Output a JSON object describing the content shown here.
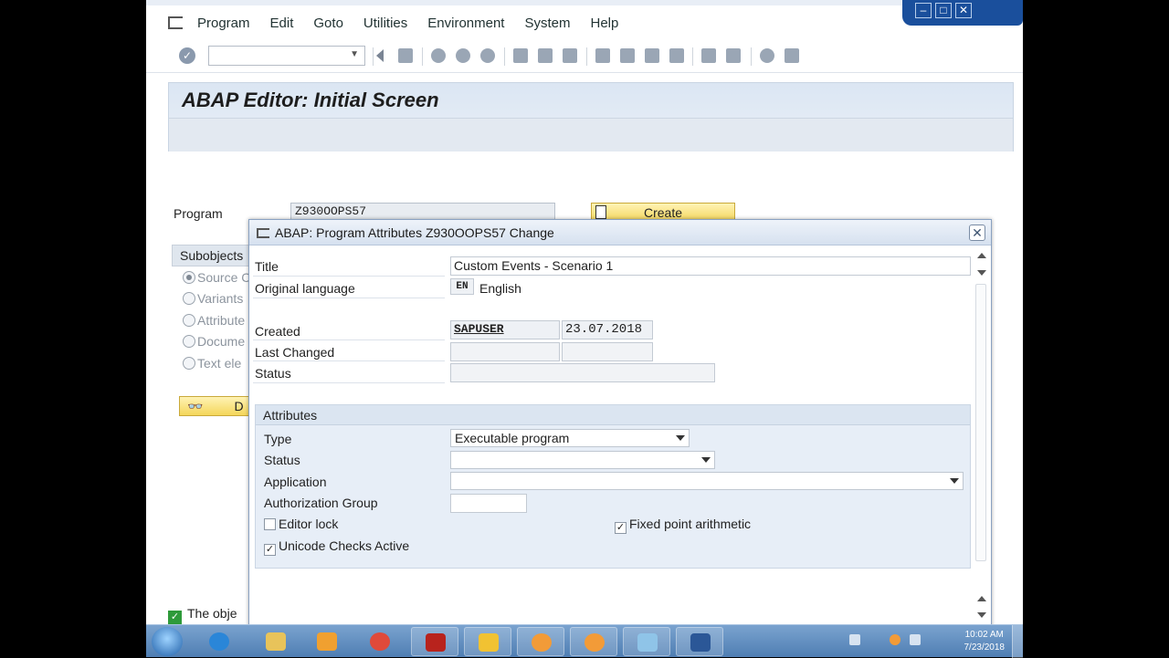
{
  "menu": {
    "items": [
      "Program",
      "Edit",
      "Goto",
      "Utilities",
      "Environment",
      "System",
      "Help"
    ]
  },
  "toolbar": {
    "command_value": ""
  },
  "screen": {
    "title": "ABAP Editor: Initial Screen",
    "program_label": "Program",
    "program_value": "Z930OOPS57",
    "create_label": "Create",
    "subobjects_label": "Subobjects",
    "radios": [
      "Source C",
      "Variants",
      "Attribute",
      "Docume",
      "Text ele"
    ],
    "display_label": "D",
    "status_message": "The obje"
  },
  "dialog": {
    "title": "ABAP: Program Attributes Z930OOPS57 Change",
    "title_label": "Title",
    "title_value": "Custom Events - Scenario 1",
    "orig_lang_label": "Original language",
    "lang_code": "EN",
    "lang_name": "English",
    "created_label": "Created",
    "created_by": "SAPUSER",
    "created_on": "23.07.2018",
    "last_changed_label": "Last Changed",
    "last_changed_by": "",
    "last_changed_on": "",
    "status_label": "Status",
    "status_value": "",
    "attributes": {
      "header": "Attributes",
      "type_label": "Type",
      "type_value": "Executable program",
      "status_label": "Status",
      "status_value": "",
      "application_label": "Application",
      "application_value": "",
      "auth_group_label": "Authorization Group",
      "auth_group_value": "",
      "editor_lock_label": "Editor lock",
      "editor_lock_checked": false,
      "fixed_point_label": "Fixed point arithmetic",
      "fixed_point_checked": true,
      "unicode_label": "Unicode Checks Active",
      "unicode_checked": true,
      "check_mark": "✓"
    }
  },
  "taskbar": {
    "time": "10:02 AM",
    "date": "7/23/2018"
  },
  "colors": {
    "sap_title_band": "#dbe6f3",
    "yellow_button": "#f4d65a",
    "taskbar": "#4f7eb3"
  }
}
